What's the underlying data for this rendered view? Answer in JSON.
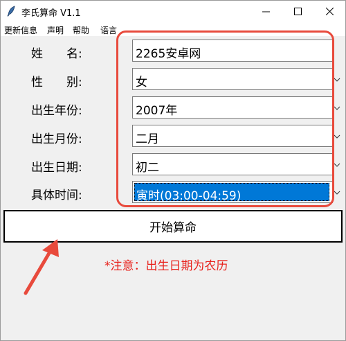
{
  "window": {
    "title": "李氏算命 V1.1",
    "icon": "feather-icon"
  },
  "menu": {
    "items": [
      "更新信息",
      "声明",
      "帮助",
      "语言"
    ]
  },
  "form": {
    "name_label": "姓　　名:",
    "name_value": "2265安卓网",
    "gender_label": "性　　别:",
    "gender_value": "女",
    "year_label": "出生年份:",
    "year_value": "2007年",
    "month_label": "出生月份:",
    "month_value": "二月",
    "day_label": "出生日期:",
    "day_value": "初二",
    "time_label": "具体时间:",
    "time_value": "寅时(03:00-04:59)"
  },
  "actions": {
    "start_label": "开始算命"
  },
  "notice": "*注意：出生日期为农历",
  "colors": {
    "annotation": "#e84a3c",
    "notice_text": "#e8201a",
    "selection": "#0078d7"
  }
}
